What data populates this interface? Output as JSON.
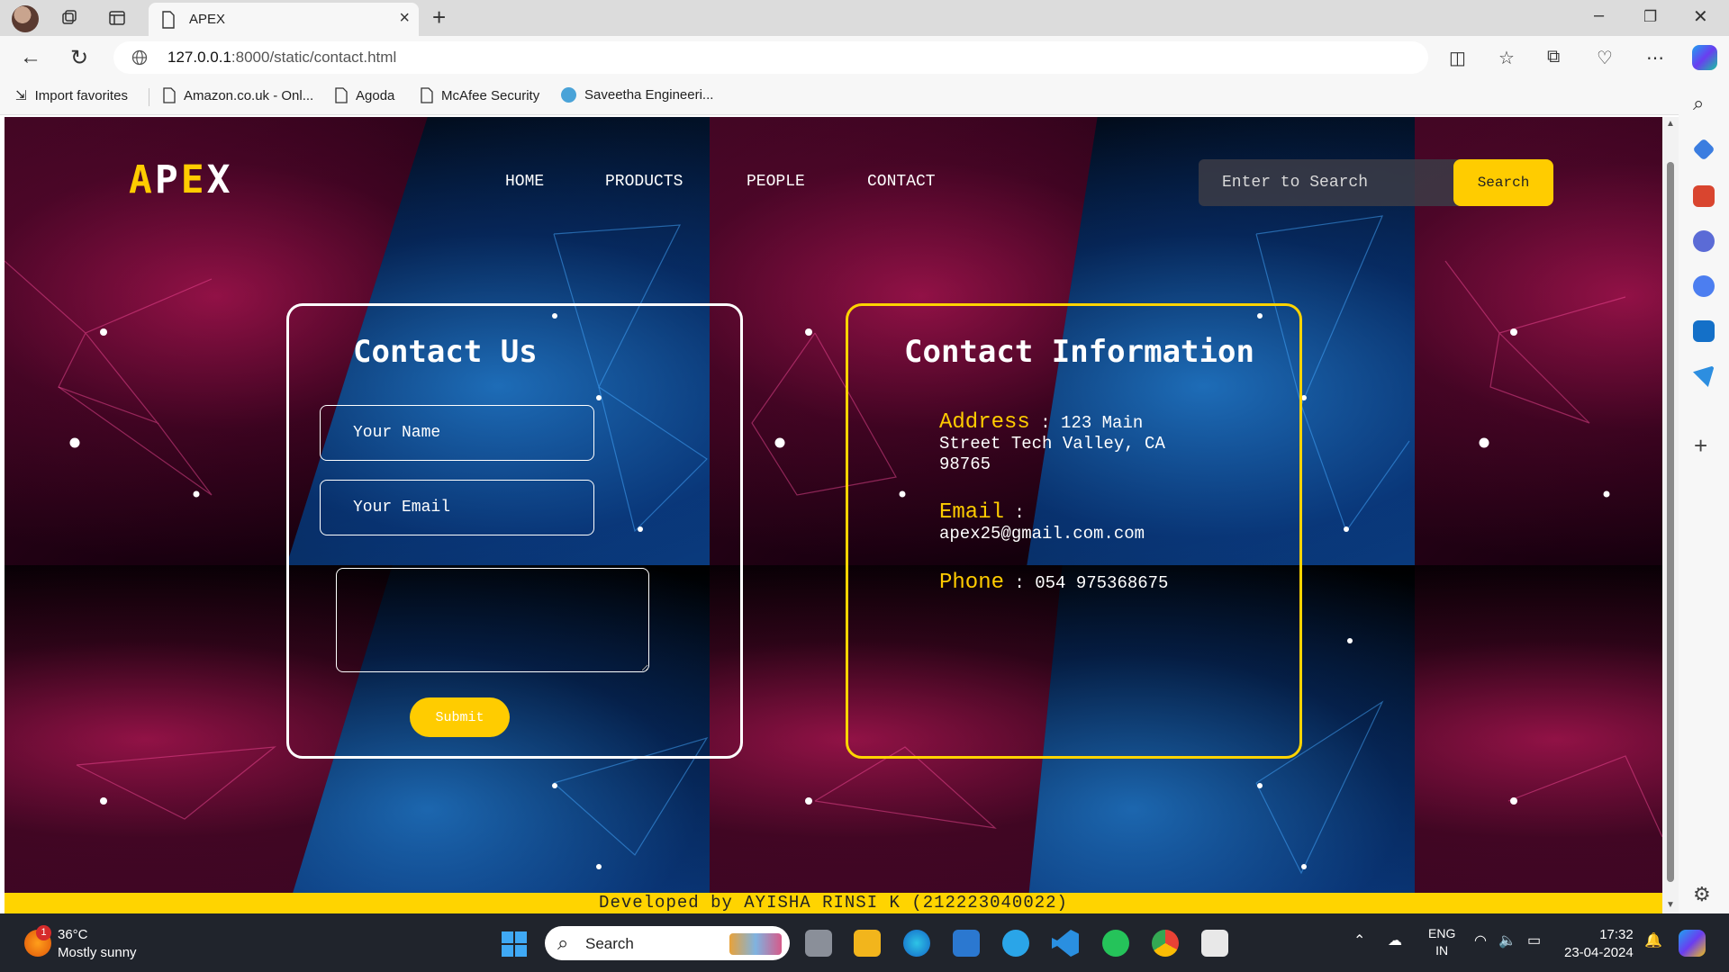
{
  "browser": {
    "tab_title": "APEX",
    "url_host": "127.0.0.1",
    "url_path": ":8000/static/contact.html",
    "favorites": [
      {
        "label": "Import favorites",
        "icon": "import-icon"
      },
      {
        "label": "Amazon.co.uk - Onl...",
        "icon": "page-icon"
      },
      {
        "label": "Agoda",
        "icon": "page-icon"
      },
      {
        "label": "McAfee Security",
        "icon": "page-icon"
      },
      {
        "label": "Saveetha Engineeri...",
        "icon": "site-icon"
      }
    ]
  },
  "site": {
    "logo": {
      "part1": "A",
      "part2": "P",
      "part3": "E",
      "part4": "X"
    },
    "nav": [
      "HOME",
      "PRODUCTS",
      "PEOPLE",
      "CONTACT"
    ],
    "search": {
      "placeholder": "Enter to Search",
      "button": "Search"
    },
    "contact_form": {
      "title": "Contact Us",
      "name_placeholder": "Your Name",
      "email_placeholder": "Your Email",
      "message_value": "",
      "submit": "Submit"
    },
    "contact_info": {
      "title": "Contact Information",
      "address_label": "Address",
      "address_value": "123 Main Street Tech Valley, CA 98765",
      "email_label": "Email",
      "email_value": "apex25@gmail.com.com",
      "phone_label": "Phone",
      "phone_value": "054 975368675",
      "separator": ":"
    },
    "footer": "Developed by AYISHA RINSI K (212223040022)"
  },
  "taskbar": {
    "weather_badge": "1",
    "temperature": "36°C",
    "condition": "Mostly sunny",
    "search_label": "Search",
    "lang_line1": "ENG",
    "lang_line2": "IN",
    "time": "17:32",
    "date": "23-04-2024"
  },
  "colors": {
    "accent": "#ffcc00",
    "background": "#020208"
  }
}
